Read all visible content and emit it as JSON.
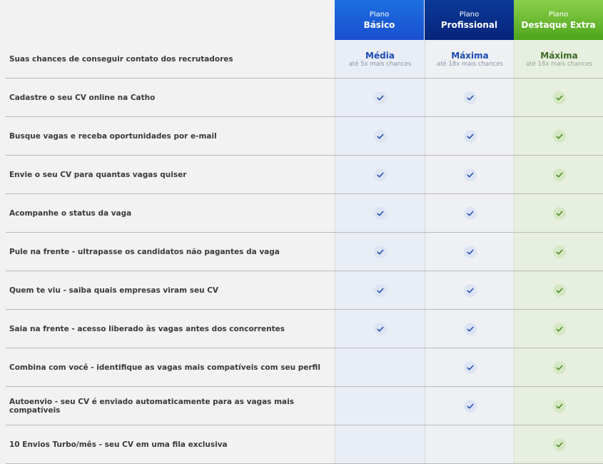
{
  "plans": [
    {
      "prefix": "Plano",
      "name": "Básico"
    },
    {
      "prefix": "Plano",
      "name": "Profissional"
    },
    {
      "prefix": "Plano",
      "name": "Destaque Extra"
    }
  ],
  "chances_row": {
    "label": "Suas chances de conseguir contato dos recrutadores",
    "values": [
      {
        "level": "Média",
        "detail": "até 5x mais chances"
      },
      {
        "level": "Máxima",
        "detail": "até 18x mais chances"
      },
      {
        "level": "Máxima",
        "detail": "até 18x mais chances"
      }
    ]
  },
  "features": [
    {
      "label": "Cadastre o seu CV online na Catho",
      "included": [
        true,
        true,
        true
      ]
    },
    {
      "label": "Busque vagas e receba oportunidades por e-mail",
      "included": [
        true,
        true,
        true
      ]
    },
    {
      "label": "Envie o seu CV para quantas vagas quiser",
      "included": [
        true,
        true,
        true
      ]
    },
    {
      "label": "Acompanhe o status da vaga",
      "included": [
        true,
        true,
        true
      ]
    },
    {
      "label": "Pule na frente - ultrapasse os candidatos não pagantes da vaga",
      "included": [
        true,
        true,
        true
      ]
    },
    {
      "label": "Quem te viu - saiba quais empresas viram seu CV",
      "included": [
        true,
        true,
        true
      ]
    },
    {
      "label": "Saia na frente - acesso liberado às vagas antes dos concorrentes",
      "included": [
        true,
        true,
        true
      ]
    },
    {
      "label": "Combina com você - identifique as vagas mais compatíveis com seu perfil",
      "included": [
        false,
        true,
        true
      ]
    },
    {
      "label": "Autoenvio - seu CV é enviado automaticamente para as vagas mais compatíveis",
      "included": [
        false,
        true,
        true
      ]
    },
    {
      "label": "10 Envios Turbo/mês - seu CV em uma fila exclusiva",
      "included": [
        false,
        false,
        true
      ]
    }
  ],
  "icons": {
    "check": "check-icon"
  },
  "colors": {
    "basico": "#1a4fd0",
    "profissional": "#06247a",
    "destaque": "#4ea51c",
    "check_blue": "#1b4bb3",
    "check_green": "#4a8a20"
  }
}
